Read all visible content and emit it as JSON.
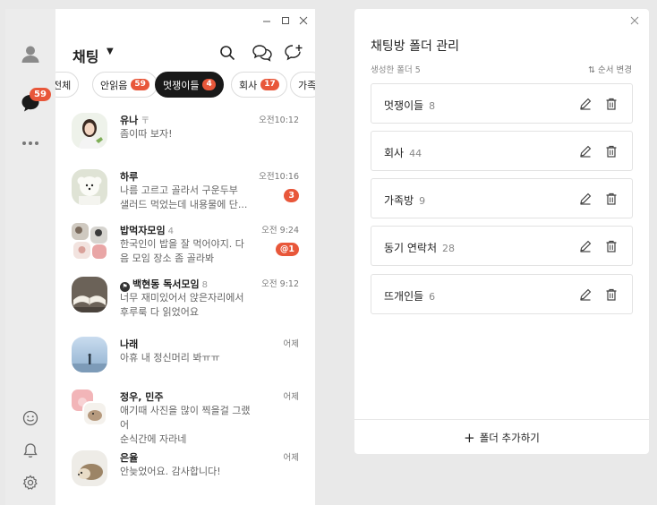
{
  "nav": {
    "unread_badge": "59"
  },
  "chat": {
    "title": "채팅",
    "tabs": [
      {
        "label": "전체",
        "count": ""
      },
      {
        "label": "안읽음",
        "count": "59"
      },
      {
        "label": "멋쟁이들",
        "count": "4"
      },
      {
        "label": "회사",
        "count": "17"
      },
      {
        "label": "가족",
        "count": ""
      }
    ],
    "rows": [
      {
        "name": "유나",
        "count": "",
        "message": "좀이따 보자!",
        "time": "오전10:12",
        "badge": ""
      },
      {
        "name": "하루",
        "count": "",
        "message": "나름 고르고 골라서 구운두부\n샐러드 먹었는데 내용물에 단...",
        "time": "오전10:16",
        "badge": "3"
      },
      {
        "name": "밥먹자모임",
        "count": "4",
        "message": "한국인이 밥을 잘 먹어야지. 다\n음 모임 장소 좀 골라봐",
        "time": "오전 9:24",
        "badge": "@1"
      },
      {
        "name": "백현동 독서모임",
        "count": "8",
        "message": "너무 재미있어서 앉은자리에서\n후루룩 다 읽었어요",
        "time": "오전 9:12",
        "badge": ""
      },
      {
        "name": "나래",
        "count": "",
        "message": "아휴 내 정신머리 봐ㅠㅠ",
        "time": "어제",
        "badge": ""
      },
      {
        "name": "정우, 민주",
        "count": "",
        "message": "애기때 사진을 많이 찍을걸 그랬어\n순식간에 자라네",
        "time": "어제",
        "badge": ""
      },
      {
        "name": "은율",
        "count": "",
        "message": "안늦었어요. 감사합니다!",
        "time": "어제",
        "badge": ""
      }
    ]
  },
  "folders": {
    "title": "채팅방 폴더 관리",
    "created_label": "생성한 폴더 5",
    "sort_label": "순서 변경",
    "items": [
      {
        "name": "멋쟁이들",
        "count": "8"
      },
      {
        "name": "회사",
        "count": "44"
      },
      {
        "name": "가족방",
        "count": "9"
      },
      {
        "name": "동기 연락처",
        "count": "28"
      },
      {
        "name": "뜨개인들",
        "count": "6"
      }
    ],
    "add_label": "폴더 추가하기"
  },
  "colors": {
    "accent": "#e8573a",
    "active_tab": "#191919"
  }
}
